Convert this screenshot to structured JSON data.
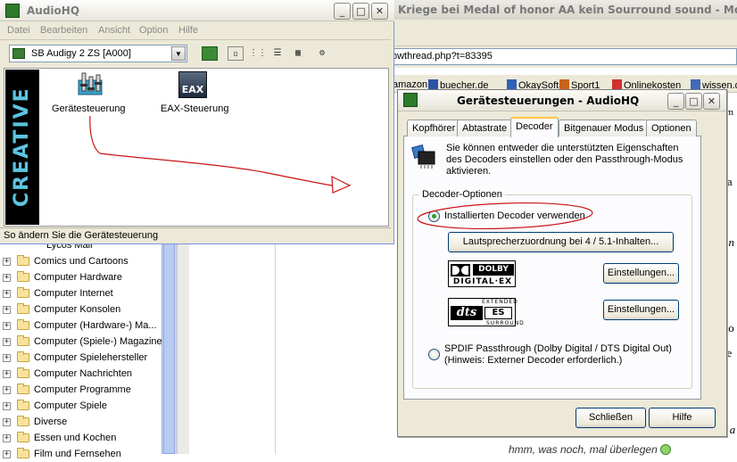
{
  "browser": {
    "title": "Kriege bei Medal of honor AA kein Sourround sound - Mozilla F",
    "url": "owthread.php?t=83395",
    "bookmarks": [
      "amazon",
      "buecher.de",
      "OkaySoft",
      "Sport1",
      "Onlinekosten",
      "wissen.d"
    ],
    "page_fragments": [
      "um i",
      "t a",
      "un",
      "s o",
      "de",
      "n a"
    ],
    "page_bottom_text": "hmm, was noch, mal überlegen"
  },
  "sidebar": {
    "partial_item": "Lycos Mail",
    "items": [
      {
        "label": "Comics und Cartoons"
      },
      {
        "label": "Computer Hardware"
      },
      {
        "label": "Computer Internet"
      },
      {
        "label": "Computer Konsolen"
      },
      {
        "label": "Computer (Hardware-) Ma..."
      },
      {
        "label": "Computer (Spiele-) Magazine"
      },
      {
        "label": "Computer Spielehersteller"
      },
      {
        "label": "Computer Nachrichten"
      },
      {
        "label": "Computer Programme"
      },
      {
        "label": "Computer Spiele"
      },
      {
        "label": "Diverse"
      },
      {
        "label": "Essen und Kochen"
      },
      {
        "label": "Film und Fernsehen"
      }
    ],
    "expand_glyph": "+"
  },
  "audiohq": {
    "title": "AudioHQ",
    "menu": [
      "Datei",
      "Bearbeiten",
      "Ansicht",
      "Option",
      "Hilfe"
    ],
    "device": "SB Audigy 2 ZS [A000]",
    "brand": "CREATIVE",
    "icons": [
      {
        "label": "Gerätesteuerung",
        "icon": "device-control-icon"
      },
      {
        "label": "EAX-Steuerung",
        "icon": "eax-icon",
        "glyph": "EAX"
      }
    ],
    "status": "So ändern Sie die Gerätesteuerung"
  },
  "dialog": {
    "title": "Gerätesteuerungen - AudioHQ",
    "tabs": [
      "Kopfhörer",
      "Abtastrate",
      "Decoder",
      "Bitgenauer Modus",
      "Optionen"
    ],
    "active_tab": "Decoder",
    "description": "Sie können entweder die unterstützten Eigenschaften des Decoders einstellen oder den Passthrough-Modus aktivieren.",
    "group_label": "Decoder-Optionen",
    "option_installed": "Installierten Decoder verwenden",
    "speaker_button": "Lautsprecherzuordnung bei 4 / 5.1-Inhalten...",
    "dolby": {
      "word": "DOLBY",
      "sub": "DIGITAL·EX",
      "settings": "Einstellungen..."
    },
    "dts": {
      "word": "dts",
      "es": "ES",
      "extended": "EXTENDED",
      "surround": "SURROUND",
      "settings": "Einstellungen..."
    },
    "option_spdif": "SPDIF Passthrough (Dolby Digital / DTS Digital Out) (Hinweis: Externer Decoder erforderlich.)",
    "close": "Schließen",
    "help": "Hilfe"
  },
  "window_controls": {
    "minimize": "_",
    "maximize": "□",
    "close": "✕"
  },
  "colors": {
    "accent": "#ffc83c",
    "creative": "#5bc5e0",
    "annotation": "#c81414"
  }
}
